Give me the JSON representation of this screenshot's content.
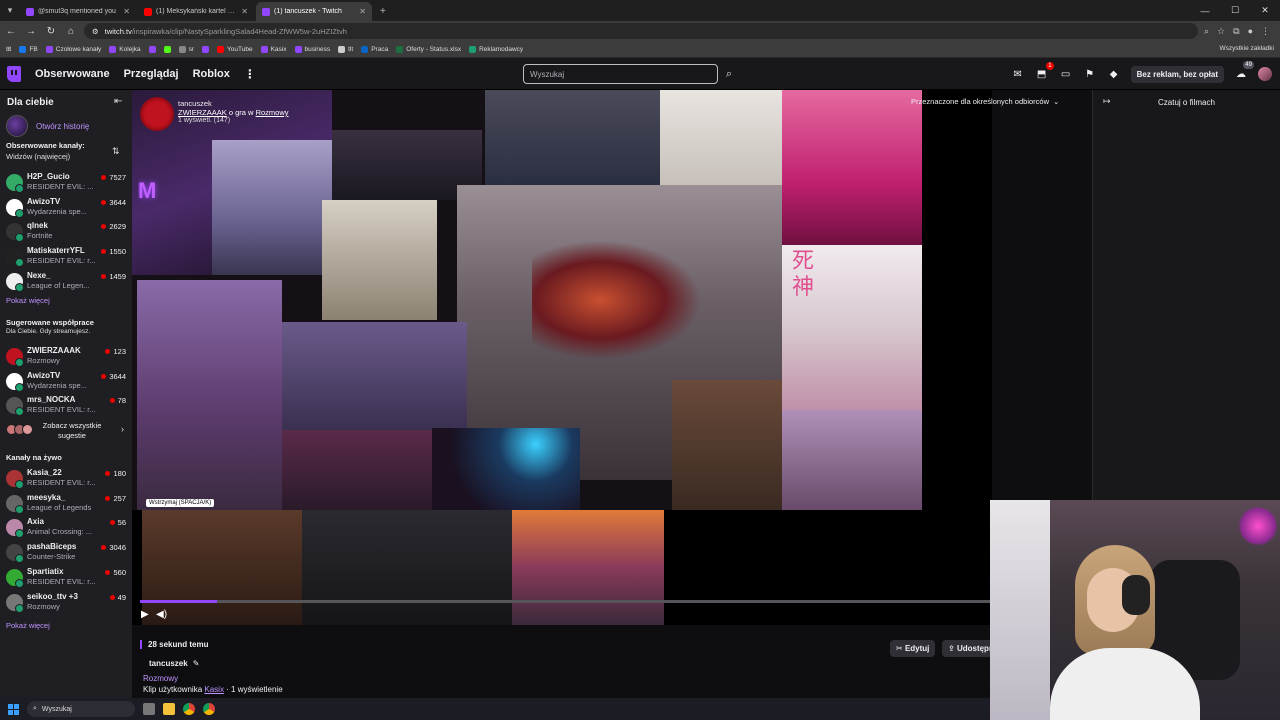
{
  "browser": {
    "tabs": [
      {
        "title": "@smut3q mentioned you",
        "color": "#9147ff",
        "active": false
      },
      {
        "title": "(1) Meksykański kartel na Podl...",
        "color": "#ff0000",
        "active": false
      },
      {
        "title": "(1) tancuszek - Twitch",
        "color": "#9147ff",
        "active": true
      }
    ],
    "new_tab": "+",
    "url_host": "twitch.tv",
    "url_path": "/inspirawka/clip/NastySparklingSalad4Head-ZfWW5w-2uHZIZtvh",
    "bookmarks": [
      {
        "label": "FB",
        "color": "#1877f2"
      },
      {
        "label": "Czołowe kanały",
        "color": "#9147ff"
      },
      {
        "label": "Kolejka",
        "color": "#9147ff"
      },
      {
        "label": "",
        "color": "#9147ff"
      },
      {
        "label": "",
        "color": "#53fc18"
      },
      {
        "label": "sr",
        "color": "#888888"
      },
      {
        "label": "",
        "color": "#9147ff"
      },
      {
        "label": "YouTube",
        "color": "#ff0000"
      },
      {
        "label": "Kasix",
        "color": "#9147ff"
      },
      {
        "label": "business",
        "color": "#9147ff"
      },
      {
        "label": "tlt",
        "color": "#cccccc"
      },
      {
        "label": "Praca",
        "color": "#0a66c2"
      },
      {
        "label": "Oferty - Status.xlsx",
        "color": "#1d6f42"
      },
      {
        "label": "Reklamodawcy",
        "color": "#1d9e75"
      }
    ],
    "bookmarks_right": "Wszystkie zakładki"
  },
  "nav": {
    "following": "Obserwowane",
    "browse": "Przeglądaj",
    "roblox": "Roblox",
    "more": "⋮",
    "search_placeholder": "Wyszukaj",
    "notif_count": "1",
    "adfree": "Bez reklam, bez opłat",
    "bits_count": "49"
  },
  "sidebar": {
    "header": "Dla ciebie",
    "history_label": "Otwórz historię",
    "followed_title": "Obserwowane kanały:",
    "followed_sort": "Widzów (najwięcej)",
    "followed": [
      {
        "name": "H2P_Gucio",
        "game": "RESIDENT EVIL: ...",
        "viewers": "7527",
        "color": "#3a6"
      },
      {
        "name": "AwizoTV",
        "game": "Wydarzenia spe...",
        "viewers": "3644",
        "color": "#fff"
      },
      {
        "name": "qlnek",
        "game": "Fortnite",
        "viewers": "2629",
        "color": "#333"
      },
      {
        "name": "MatiskaterrYFL",
        "game": "RESIDENT EVIL: r...",
        "viewers": "1550",
        "color": "#222"
      },
      {
        "name": "Nexe_",
        "game": "League of Legen...",
        "viewers": "1459",
        "color": "#eee"
      }
    ],
    "show_more_1": "Pokaż więcej",
    "suggested_title": "Sugerowane współprace",
    "suggested_sub": "Dla Ciebie. Gdy streamujesz.",
    "suggested": [
      {
        "name": "ZWIERZAAAK",
        "game": "Rozmowy",
        "viewers": "123",
        "color": "#c1121f"
      },
      {
        "name": "AwizoTV",
        "game": "Wydarzenia spe...",
        "viewers": "3644",
        "color": "#fff"
      },
      {
        "name": "mrs_NOCKA",
        "game": "RESIDENT EVIL: r...",
        "viewers": "78",
        "color": "#555"
      }
    ],
    "see_all": "Zobacz wszystkie sugestie",
    "live_title": "Kanały na żywo",
    "live": [
      {
        "name": "Kasia_22",
        "game": "RESIDENT EVIL: r...",
        "viewers": "180",
        "color": "#a33"
      },
      {
        "name": "meesyka_",
        "game": "League of Legends",
        "viewers": "257",
        "color": "#666"
      },
      {
        "name": "Axia",
        "game": "Animal Crossing: ...",
        "viewers": "56",
        "color": "#b8a"
      },
      {
        "name": "pashaBiceps",
        "game": "Counter-Strike",
        "viewers": "3046",
        "color": "#444"
      },
      {
        "name": "Spartiatix",
        "game": "RESIDENT EVIL: r...",
        "viewers": "560",
        "color": "#3a3"
      },
      {
        "name": "seikoo_ttv +3",
        "game": "Rozmowy",
        "viewers": "49",
        "color": "#777"
      }
    ],
    "show_more_2": "Pokaż więcej"
  },
  "clip": {
    "channel_title": "tancuszek",
    "line2_user": "ZWIERZAAAK",
    "line2_mid": "o gra w",
    "line2_cat": "Rozmowy",
    "line3": "1 wyświetl. (147)",
    "audience": "Przeznaczone dla określonych odbiorców",
    "tooltip": "Wstrzymaj (SPACJA/K)",
    "progress": 0.09,
    "ago": "28 sekund temu",
    "clipper": "tancuszek",
    "category": "Rozmowy",
    "byline_pre": "Klip użytkownika",
    "byline_user": "Kasix",
    "byline_post": "· 1 wyświetlenie",
    "edit": "Edytuj",
    "share": "Udostępnij"
  },
  "right_panel": {
    "title": "Czatuj o filmach"
  },
  "taskbar": {
    "search": "Wyszukaj"
  }
}
